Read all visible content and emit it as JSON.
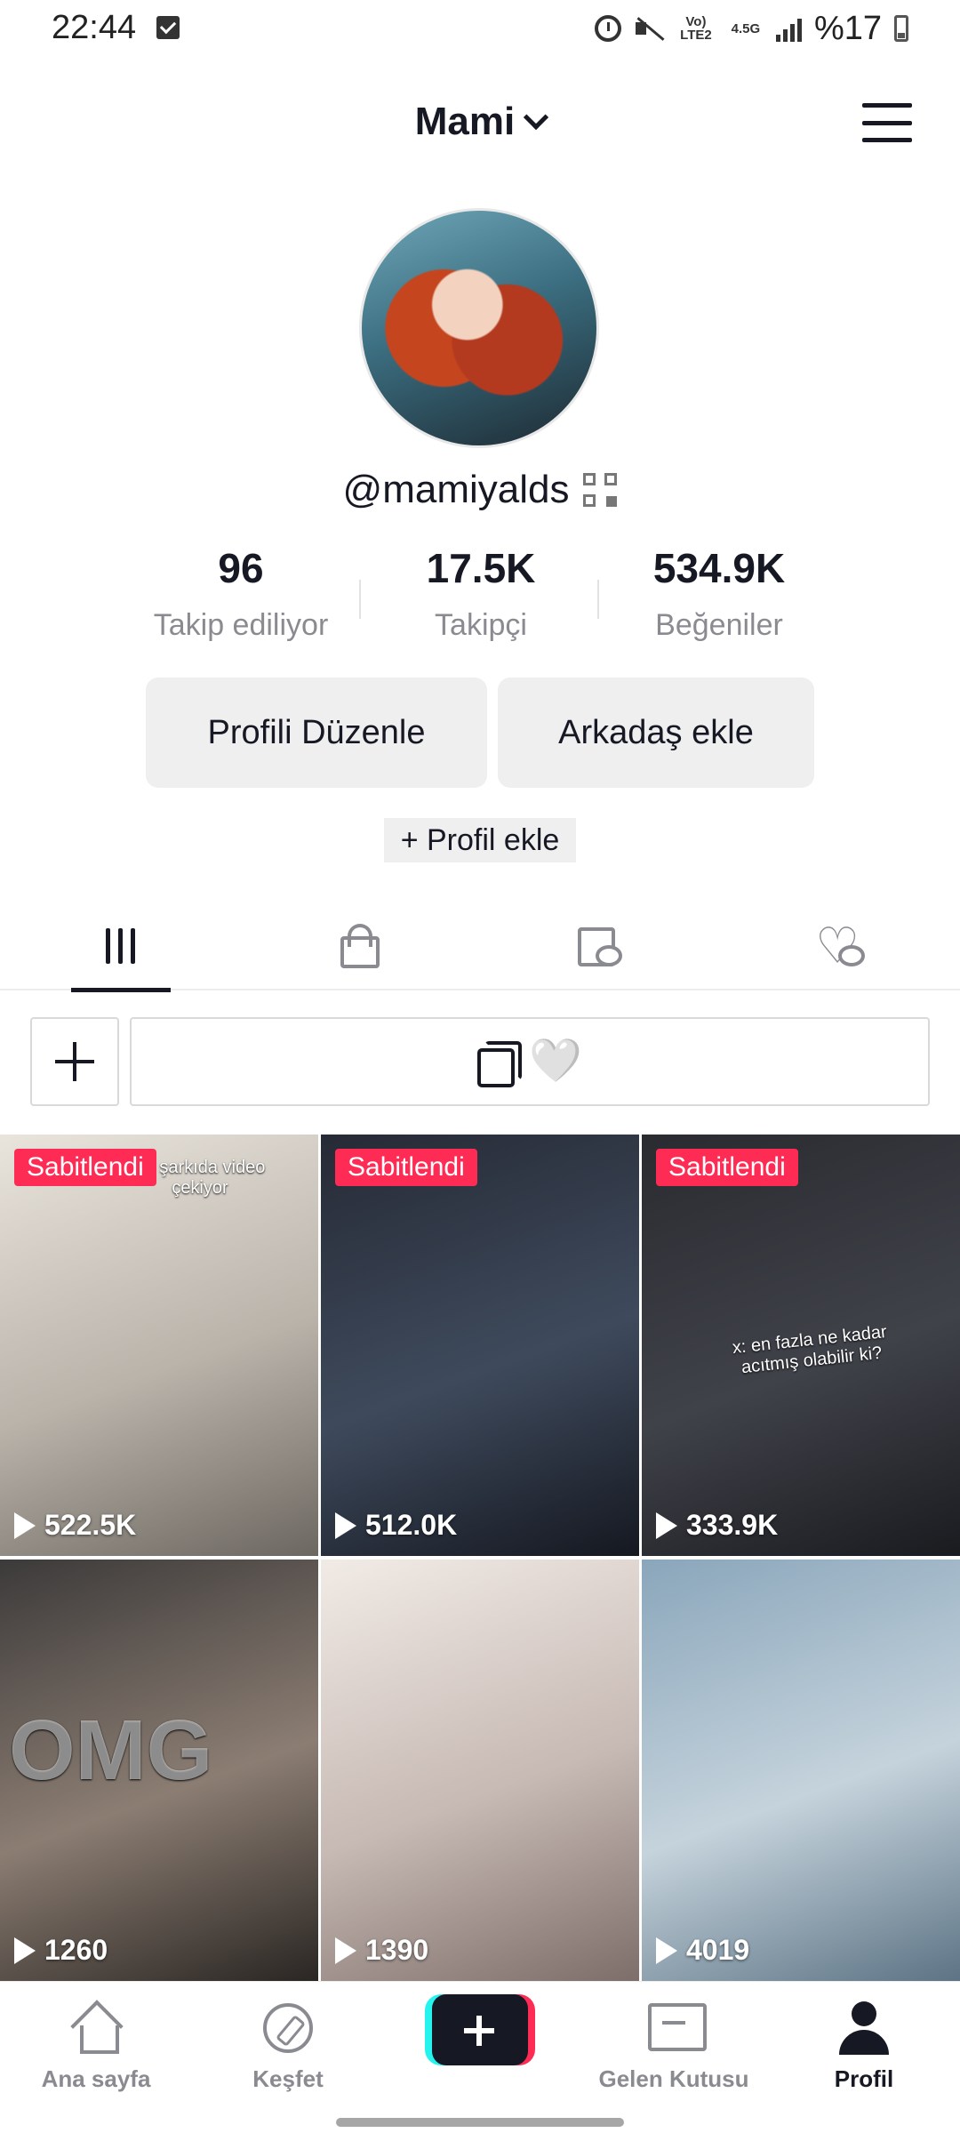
{
  "status_bar": {
    "time": "22:44",
    "network": "Vo) LTE2",
    "network_type": "4.5G",
    "battery": "%17"
  },
  "header": {
    "title": "Mami"
  },
  "profile": {
    "username": "@mamiyalds",
    "stats": [
      {
        "value": "96",
        "label": "Takip ediliyor"
      },
      {
        "value": "17.5K",
        "label": "Takipçi"
      },
      {
        "value": "534.9K",
        "label": "Beğeniler"
      }
    ],
    "edit_button": "Profili Düzenle",
    "add_friend_button": "Arkadaş ekle",
    "add_profile": "+ Profil ekle"
  },
  "tabs": [
    "videos-grid",
    "private-lock",
    "reposts",
    "liked"
  ],
  "playlist": {
    "heart": "🤍"
  },
  "videos": [
    {
      "pinned": "Sabitlendi",
      "views": "522.5K",
      "caption": "bu şarkıda video çekiyor",
      "colors": [
        "#e9e4dc",
        "#b9b3aa",
        "#6c6760"
      ]
    },
    {
      "pinned": "Sabitlendi",
      "views": "512.0K",
      "caption": "",
      "colors": [
        "#262a35",
        "#3e4a5c",
        "#151820"
      ]
    },
    {
      "pinned": "Sabitlendi",
      "views": "333.9K",
      "caption": "x: en fazla ne kadar acıtmış olabilir ki?",
      "colors": [
        "#2a2b30",
        "#40424a",
        "#1a1b1f"
      ]
    },
    {
      "pinned": "",
      "views": "1260",
      "caption": "OMG",
      "colors": [
        "#3c3a3a",
        "#8b7d72",
        "#2a2623"
      ]
    },
    {
      "pinned": "",
      "views": "1390",
      "caption": "",
      "colors": [
        "#f1ebe6",
        "#c7b9b3",
        "#7d6e6a"
      ]
    },
    {
      "pinned": "",
      "views": "4019",
      "caption": "",
      "colors": [
        "#8aa6bb",
        "#c5d3dc",
        "#5d7485"
      ]
    }
  ],
  "bottom_nav": [
    {
      "label": "Ana sayfa",
      "icon": "home-icon"
    },
    {
      "label": "Keşfet",
      "icon": "compass-icon"
    },
    {
      "label": "",
      "icon": "create-icon"
    },
    {
      "label": "Gelen Kutusu",
      "icon": "inbox-icon"
    },
    {
      "label": "Profil",
      "icon": "profile-icon"
    }
  ]
}
